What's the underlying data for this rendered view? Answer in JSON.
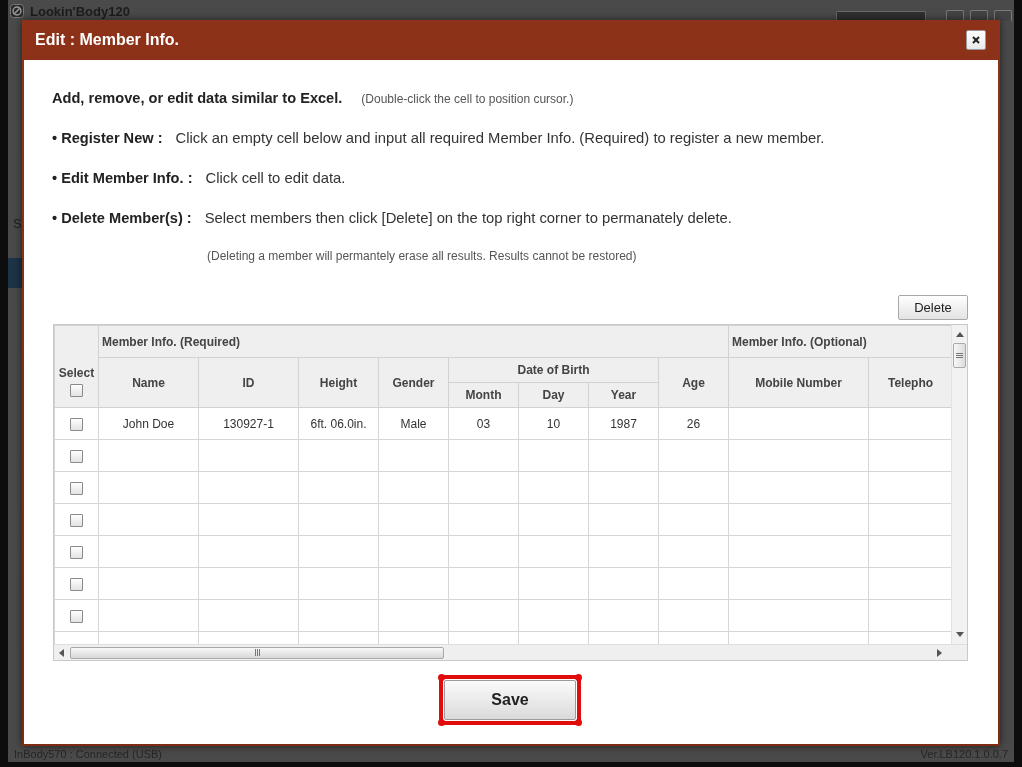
{
  "app": {
    "title": "Lookin'Body120",
    "side_label": "S",
    "status": "InBody570 : Connected (USB)",
    "version": "Ver.LB120.1.0.0.7"
  },
  "dialog": {
    "title": "Edit : Member Info.",
    "intro": {
      "text": "Add, remove, or edit data similar to Excel.",
      "hint": "(Double-click the cell to position cursor.)"
    },
    "instructions": [
      {
        "label": "• Register New :",
        "text": "Click an empty cell below and input all required Member Info. (Required) to register a new member."
      },
      {
        "label": "• Edit Member Info. :",
        "text": "Click cell to edit data."
      },
      {
        "label": "• Delete Member(s) :",
        "text": "Select members then click [Delete] on the top right corner to permanately delete."
      }
    ],
    "warning": "(Deleting a member will permantely erase all results. Results cannot be restored)",
    "delete_button": "Delete",
    "table": {
      "select_label": "Select",
      "select_all_checked": false,
      "groups": [
        {
          "label": "Member Info. (Required)",
          "columns": [
            {
              "label": "Name"
            },
            {
              "label": "ID"
            },
            {
              "label": "Height"
            },
            {
              "label": "Gender"
            },
            {
              "label": "Date of Birth",
              "children": [
                {
                  "label": "Month"
                },
                {
                  "label": "Day"
                },
                {
                  "label": "Year"
                }
              ]
            },
            {
              "label": "Age"
            }
          ]
        },
        {
          "label": "Member Info. (Optional)",
          "columns": [
            {
              "label": "Mobile Number"
            },
            {
              "label": "Telepho"
            }
          ]
        }
      ],
      "rows": [
        {
          "checked": false,
          "cells": [
            "John Doe",
            "130927-1",
            "6ft. 06.0in.",
            "Male",
            "03",
            "10",
            "1987",
            "26"
          ]
        },
        {
          "checked": false
        },
        {
          "checked": false
        },
        {
          "checked": false
        },
        {
          "checked": false
        },
        {
          "checked": false
        },
        {
          "checked": false
        }
      ]
    },
    "save_button": {
      "label": "Save",
      "highlighted": true
    }
  }
}
